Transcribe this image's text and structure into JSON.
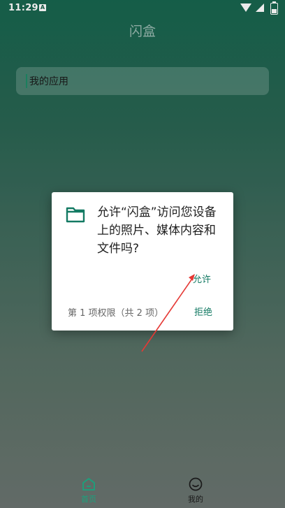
{
  "status_bar": {
    "time": "11:29",
    "notification_icon": "a-icon",
    "icons": [
      "wifi-icon",
      "signal-icon",
      "battery-icon"
    ]
  },
  "app": {
    "title": "闪盒"
  },
  "search": {
    "value": "我的应用"
  },
  "dialog": {
    "icon": "folder-icon",
    "message": "允许“闪盒”访问您设备上的照片、媒体内容和文件吗?",
    "allow_label": "允许",
    "deny_label": "拒绝",
    "permission_count": "第 1 项权限（共 2 项）"
  },
  "bottom_nav": {
    "items": [
      {
        "label": "首页",
        "icon": "home-icon",
        "active": true
      },
      {
        "label": "我的",
        "icon": "smile-icon",
        "active": false
      }
    ]
  },
  "colors": {
    "accent": "#137a63",
    "nav_active": "#1aa27d",
    "annotation_arrow": "#e53935"
  }
}
